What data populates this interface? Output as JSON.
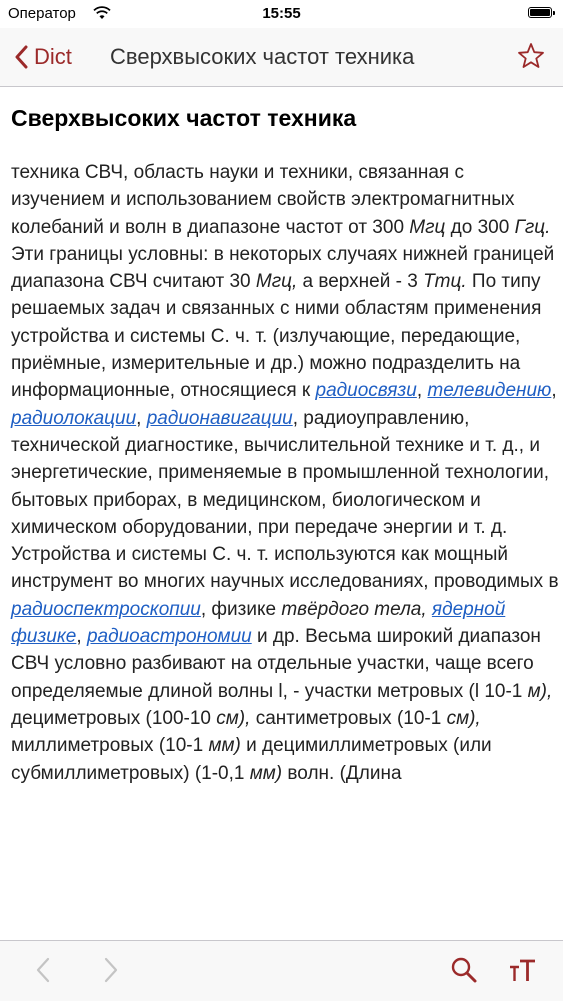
{
  "status_bar": {
    "carrier": "Оператор",
    "time": "15:55",
    "battery_level": 1.0
  },
  "nav": {
    "back_label": "Dict",
    "title": "Сверхвысоких частот техника",
    "accent_color": "#9b2a2a",
    "star_icon": "star-outline-icon"
  },
  "article": {
    "title": "Сверхвысоких частот техника",
    "body": [
      {
        "t": "техника СВЧ, область науки и техники, связанная с изучением и использованием свойств электромагнитных колебаний и волн в диапазоне частот от 300 "
      },
      {
        "t": "Мгц",
        "i": true
      },
      {
        "t": " до 300 "
      },
      {
        "t": "Ггц.",
        "i": true
      },
      {
        "t": " Эти границы условны: в некоторых случаях нижней границей диапазона СВЧ считают 30 "
      },
      {
        "t": "Мгц,",
        "i": true
      },
      {
        "t": " а верхней - 3 "
      },
      {
        "t": "Ттц.",
        "i": true
      },
      {
        "t": " По типу решаемых задач и связанных с ними областям применения устройства и системы С. ч. т. (излучающие, передающие, приёмные, измерительные и др.) можно подразделить на информационные, относящиеся к "
      },
      {
        "t": "радиосвязи",
        "link": true
      },
      {
        "t": ", "
      },
      {
        "t": "телевидению",
        "link": true
      },
      {
        "t": ", "
      },
      {
        "t": "радиолокации",
        "link": true
      },
      {
        "t": ", "
      },
      {
        "t": "радионавигации",
        "link": true
      },
      {
        "t": ", радиоуправлению, технической диагностике, вычислительной технике и т. д., и энергетические, применяемые в промышленной технологии, бытовых приборах, в медицинском, биологическом и химическом оборудовании, при передаче энергии и т. д. Устройства и системы С. ч. т. используются как мощный инструмент во многих научных исследованиях, проводимых в "
      },
      {
        "t": "радиоспектроскопии",
        "link": true
      },
      {
        "t": ", физике "
      },
      {
        "t": "твёрдого тела,",
        "i": true
      },
      {
        "t": " "
      },
      {
        "t": "ядерной физике",
        "link": true
      },
      {
        "t": ", "
      },
      {
        "t": "радиоастрономии",
        "link": true
      },
      {
        "t": " и др. Весьма широкий диапазон СВЧ условно разбивают на отдельные участки, чаще всего определяемые длиной волны l, - участки метровых (l 10-1 "
      },
      {
        "t": "м),",
        "i": true
      },
      {
        "t": " дециметровых (100-10 "
      },
      {
        "t": "см),",
        "i": true
      },
      {
        "t": " сантиметровых (10-1 "
      },
      {
        "t": "см),",
        "i": true
      },
      {
        "t": " миллиметровых (10-1 "
      },
      {
        "t": "мм)",
        "i": true
      },
      {
        "t": " и децимиллиметровых (или субмиллиметровых) (1-0,1 "
      },
      {
        "t": "мм)",
        "i": true
      },
      {
        "t": " волн. (Длина"
      }
    ]
  },
  "link_color": "#1f5fc4",
  "toolbar": {
    "items": [
      "back-arrow-icon",
      "forward-arrow-icon",
      "search-icon",
      "font-size-icon"
    ]
  }
}
